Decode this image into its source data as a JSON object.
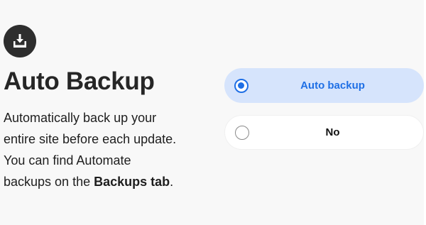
{
  "feature": {
    "icon": "download-tray-icon",
    "title": "Auto Backup",
    "description_lines": [
      "Automatically back up your",
      "entire site before each update.",
      "You can find Automate",
      "backups on the "
    ],
    "description_bold": "Backups tab",
    "description_end": "."
  },
  "options": [
    {
      "label": "Auto backup",
      "selected": true
    },
    {
      "label": "No",
      "selected": false
    }
  ],
  "colors": {
    "accent": "#1f6fe5",
    "selected_bg": "#d6e4fc",
    "panel_bg": "#f8f8f8",
    "icon_bg": "#2e2e2e"
  }
}
